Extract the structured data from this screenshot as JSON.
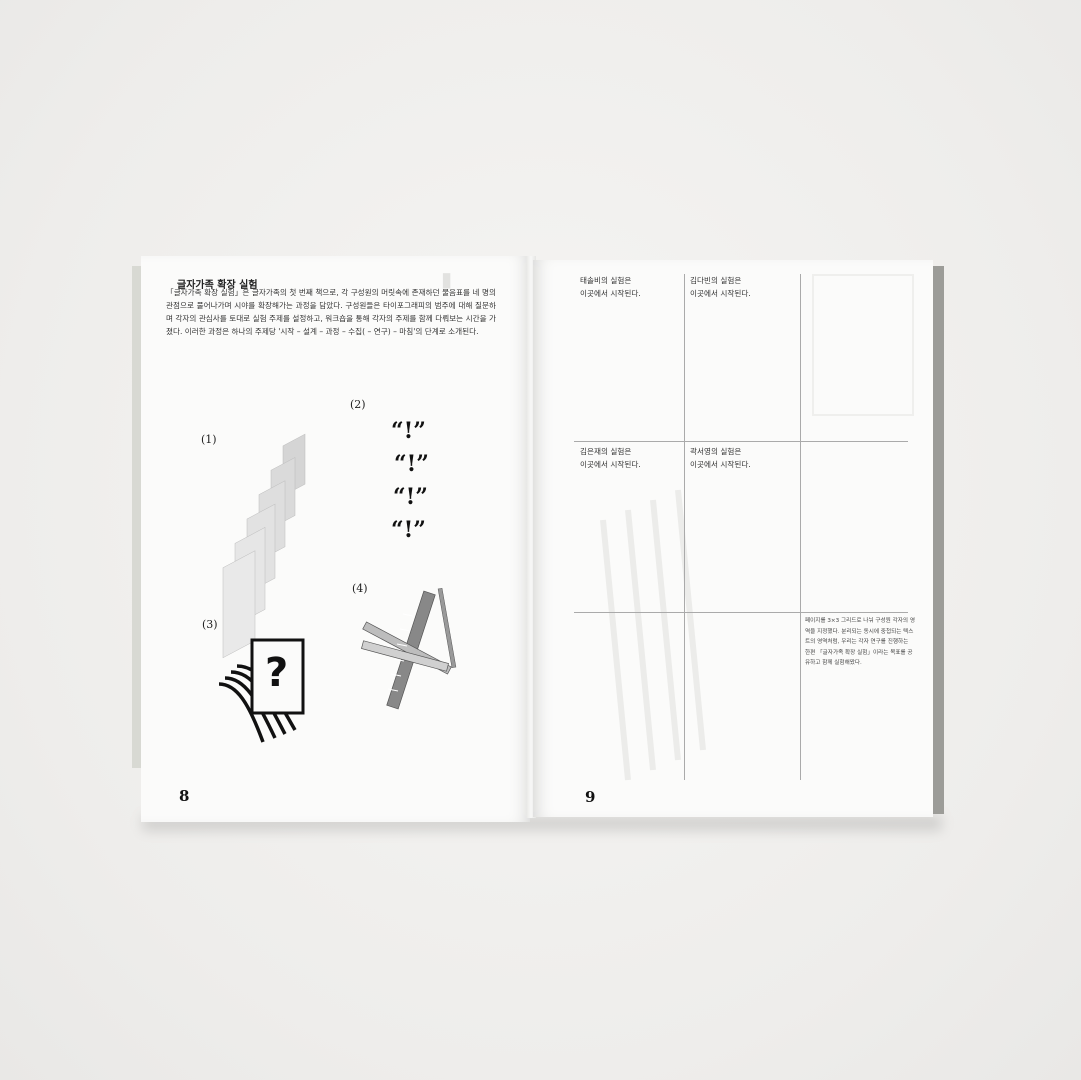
{
  "left_page": {
    "heading": "글자가족 확장 실험",
    "body": "「글자가족 확장 실험」은 글자가족의 첫 번째 책으로, 각 구성원의 머릿속에 존재하던 물음표를 네 명의 관점으로 풀어나가며 시야를 확장해가는 과정을 담았다. 구성원들은 타이포그래피의 범주에 대해 질문하며 각자의 관심사를 토대로 실험 주제를 설정하고, 워크숍을 통해 각자의 주제를 함께 다뤄보는 시간을 가졌다. 이러한 과정은 하나의 주제당 '시작 – 설계 – 과정 – 수집( – 연구) – 마침'의 단계로 소개된다.",
    "figures": [
      {
        "label": "(1)"
      },
      {
        "label": "(2)",
        "glyphs": [
          "“!”",
          "“!”",
          "“!”",
          "“!”"
        ]
      },
      {
        "label": "(3)",
        "glyph": "?"
      },
      {
        "label": "(4)"
      }
    ],
    "page_number": "8"
  },
  "right_page": {
    "cells": [
      {
        "line1": "태솔비의 실험은",
        "line2": "이곳에서 시작된다."
      },
      {
        "line1": "김다빈의 실험은",
        "line2": "이곳에서 시작된다."
      },
      {
        "line1": "김은재의 실험은",
        "line2": "이곳에서 시작된다."
      },
      {
        "line1": "곽서영의 실험은",
        "line2": "이곳에서 시작된다."
      }
    ],
    "note": "페이지를 3×3 그리드로 나눠 구성원 각자의 영역을 지정했다. 분리되는 동시에 중첩되는 텍스트의 영역처럼, 우리는 각자 연구를 진행하는 한편 「글자가족 확장 실험」이라는 목표를 공유하고 함께 실험해왔다.",
    "page_number": "9"
  },
  "colors": {
    "paper": "#fbfbfa",
    "background": "#f1f0ee",
    "ink": "#111111",
    "grid": "#aaaaaa"
  }
}
